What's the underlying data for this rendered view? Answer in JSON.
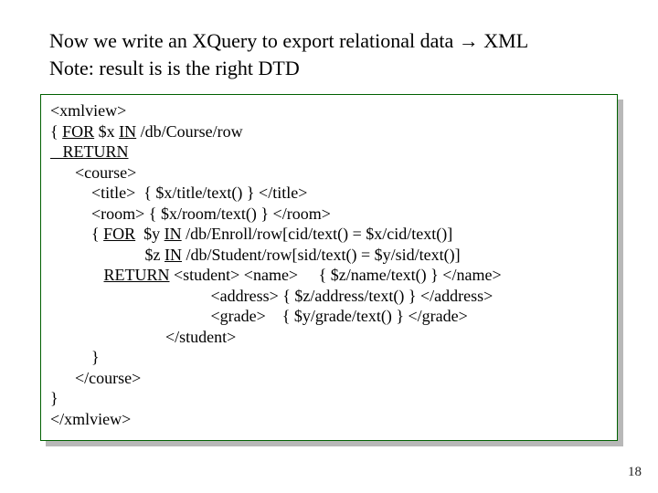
{
  "intro": {
    "line1a": "Now we write an XQuery to export relational data ",
    "arrow": "→",
    "line1b": " XML",
    "line2": "Note: result is is the right DTD"
  },
  "code": {
    "l01": "<xmlview>",
    "l02a": "{ ",
    "l02_for": "FOR",
    "l02b": " $x ",
    "l02_in": "IN",
    "l02c": " /db/Course/row",
    "l03_return": "   RETURN",
    "l04": "      <course>",
    "l05": "          <title>  { $x/title/text() } </title>",
    "l06": "          <room> { $x/room/text() } </room>",
    "l07a": "          { ",
    "l07_for": "FOR",
    "l07b": "  $y ",
    "l07_in": "IN",
    "l07c": " /db/Enroll/row[cid/text() = $x/cid/text()]",
    "l08a": "                       $z ",
    "l08_in": "IN",
    "l08b": " /db/Student/row[sid/text() = $y/sid/text()]",
    "l09a": "             ",
    "l09_return": "RETURN",
    "l09b": " <student> <name>     { $z/name/text() } </name>",
    "l10": "                                       <address> { $z/address/text() } </address>",
    "l11": "                                       <grade>    { $y/grade/text() } </grade>",
    "l12": "                            </student>",
    "l13": "          }",
    "l14": "      </course>",
    "l15": "}",
    "l16": "</xmlview>"
  },
  "pagenum": "18"
}
